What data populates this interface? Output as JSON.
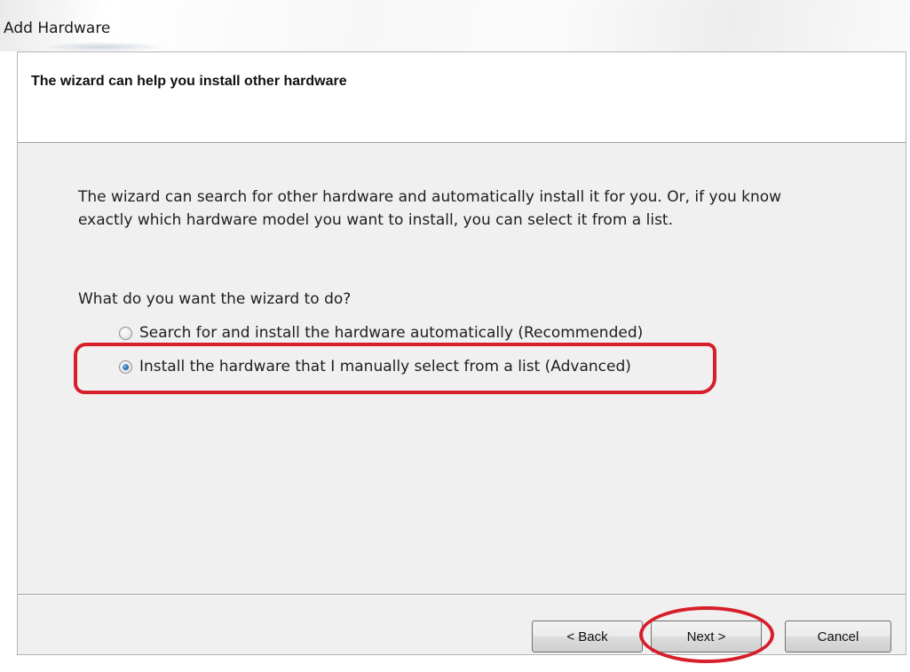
{
  "window": {
    "title": "Add Hardware"
  },
  "header": {
    "title": "The wizard can help you install other hardware"
  },
  "body": {
    "description": "The wizard can search for other hardware and automatically install it for you. Or, if you know exactly which hardware model you want to install, you can select it from a list.",
    "question": "What do you want the wizard to do?",
    "options": [
      {
        "label": "Search for and install the hardware automatically (Recommended)",
        "checked": false
      },
      {
        "label": "Install the hardware that I manually select from a list (Advanced)",
        "checked": true
      }
    ]
  },
  "buttons": {
    "back": "< Back",
    "next": "Next >",
    "cancel": "Cancel"
  },
  "colors": {
    "annotation": "#d71f2b",
    "radio_selected": "#2a6cb3"
  }
}
